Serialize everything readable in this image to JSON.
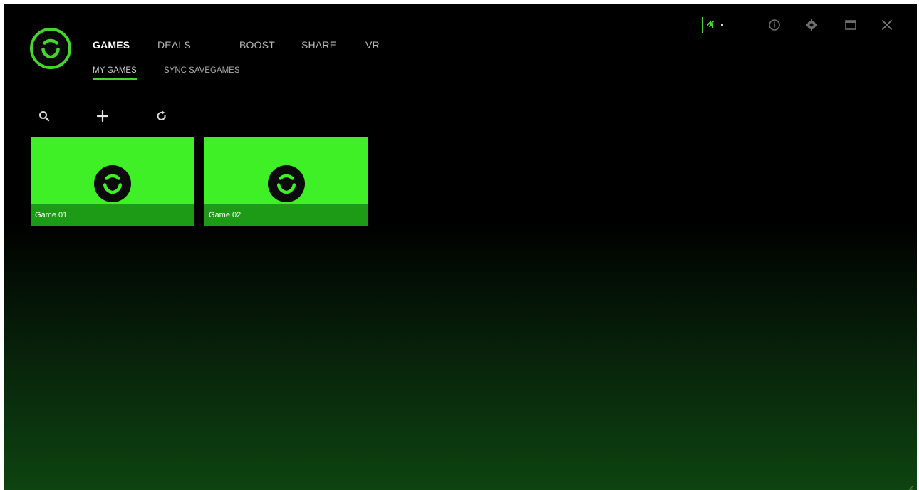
{
  "nav": {
    "tabs": [
      {
        "label": "GAMES",
        "active": true
      },
      {
        "label": "DEALS",
        "active": false
      },
      {
        "label": "BOOST",
        "active": false
      },
      {
        "label": "SHARE",
        "active": false
      },
      {
        "label": "VR",
        "active": false
      }
    ],
    "subtabs": [
      {
        "label": "MY GAMES",
        "active": true
      },
      {
        "label": "SYNC SAVEGAMES",
        "active": false
      }
    ]
  },
  "toolbar": {
    "icons": [
      "search-icon",
      "plus-icon",
      "refresh-icon"
    ]
  },
  "games": [
    {
      "name": "Game 01",
      "icon": "cortex-logo-icon"
    },
    {
      "name": "Game 02",
      "icon": "cortex-logo-icon"
    }
  ],
  "window_controls": [
    "razer-account-icon",
    "info-icon",
    "settings-icon",
    "maximize-icon",
    "close-icon"
  ],
  "colors": {
    "accent": "#44d62c",
    "tile_background": "#3ef025",
    "tile_label_bar": "#1d9a16",
    "background_top": "#000000",
    "background_bottom": "#0d4410"
  }
}
